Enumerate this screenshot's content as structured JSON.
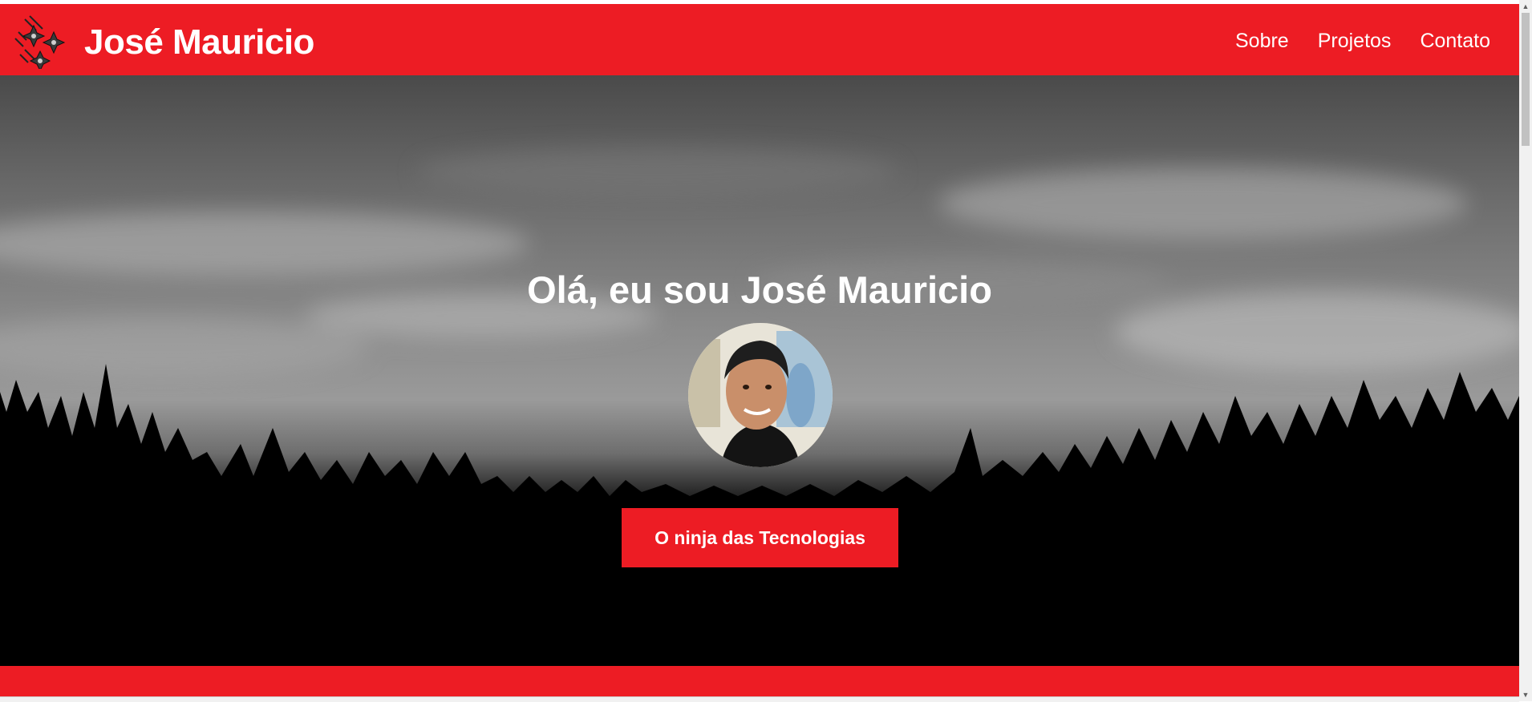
{
  "header": {
    "brand_name": "José Mauricio",
    "nav_items": [
      {
        "label": "Sobre"
      },
      {
        "label": "Projetos"
      },
      {
        "label": "Contato"
      }
    ],
    "logo_icon": "shuriken-logo-icon"
  },
  "hero": {
    "title": "Olá, eu sou José Mauricio",
    "tagline_button": "O ninja das Tecnologias",
    "background": "grayscale-forest-sky-image"
  },
  "colors": {
    "accent": "#ed1c24",
    "text": "#ffffff"
  }
}
